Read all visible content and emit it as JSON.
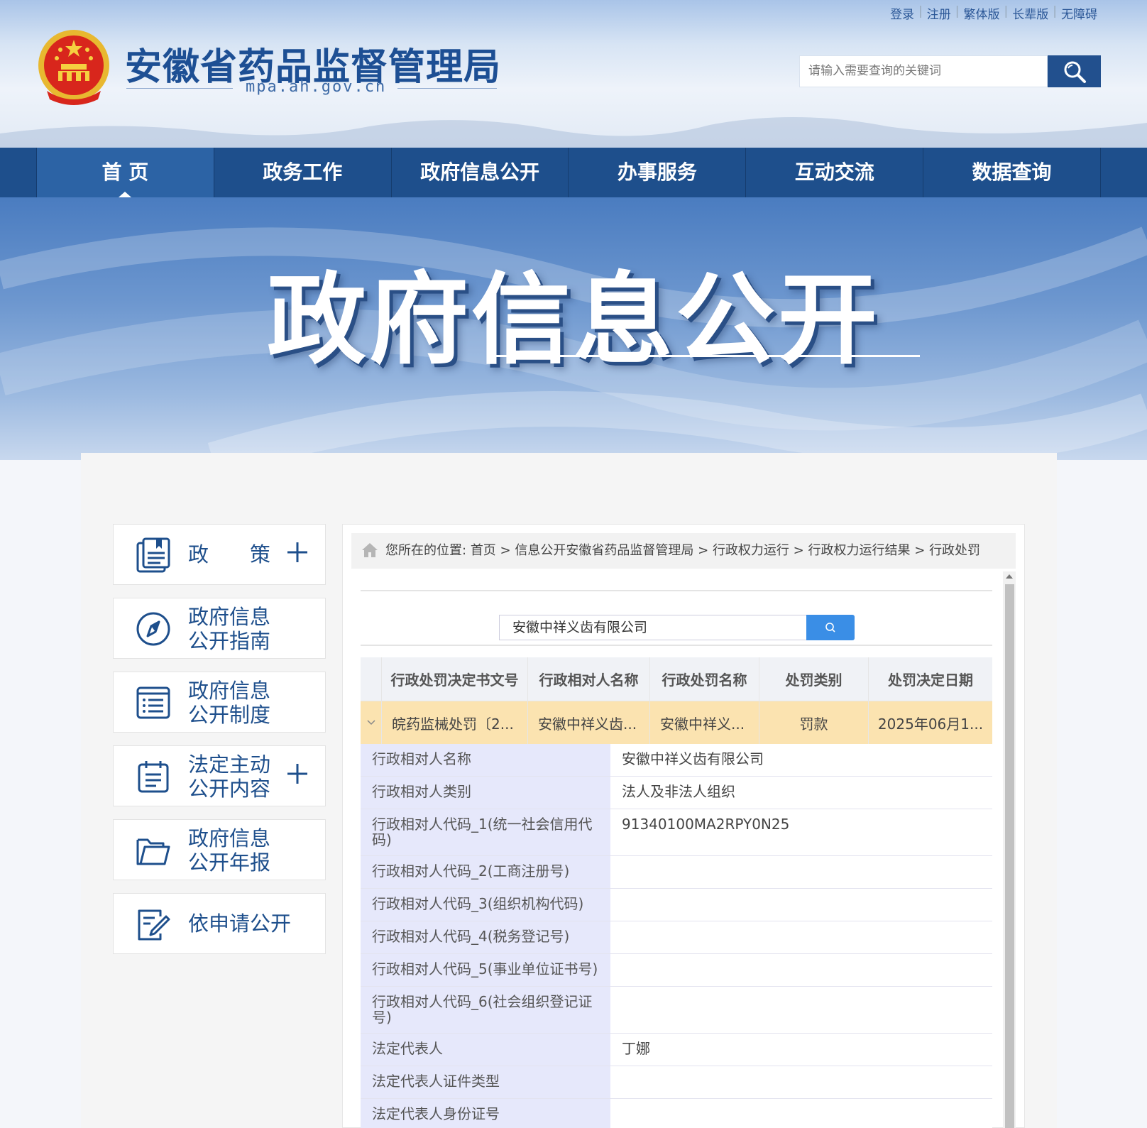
{
  "top_links": [
    "登录",
    "注册",
    "繁体版",
    "长辈版",
    "无障碍"
  ],
  "site": {
    "title": "安徽省药品监督管理局",
    "domain": "mpa.ah.gov.cn"
  },
  "search": {
    "placeholder": "请输入需要查询的关键词"
  },
  "nav": [
    "首 页",
    "政务工作",
    "政府信息公开",
    "办事服务",
    "互动交流",
    "数据查询"
  ],
  "banner": {
    "title": "政府信息公开"
  },
  "sidebar": [
    {
      "label": "政　　策",
      "icon": "document-icon",
      "has_plus": true
    },
    {
      "label": "政府信息\n公开指南",
      "icon": "compass-icon",
      "has_plus": false
    },
    {
      "label": "政府信息\n公开制度",
      "icon": "list-icon",
      "has_plus": false
    },
    {
      "label": "法定主动\n公开内容",
      "icon": "calendar-icon",
      "has_plus": true
    },
    {
      "label": "政府信息\n公开年报",
      "icon": "folder-icon",
      "has_plus": false
    },
    {
      "label": "依申请公开",
      "icon": "edit-icon",
      "has_plus": false
    }
  ],
  "breadcrumb": {
    "prefix": "您所在的位置:",
    "items": [
      "首页",
      "信息公开安徽省药品监督管理局",
      "行政权力运行",
      "行政权力运行结果",
      "行政处罚"
    ],
    "separator": ">"
  },
  "query": {
    "value": "安徽中祥义齿有限公司"
  },
  "table": {
    "headers": [
      "行政处罚决定书文号",
      "行政相对人名称",
      "行政处罚名称",
      "处罚类别",
      "处罚决定日期"
    ],
    "row": [
      "皖药监械处罚〔2...",
      "安徽中祥义齿...",
      "安徽中祥义...",
      "罚款",
      "2025年06月1..."
    ]
  },
  "details": [
    {
      "label": "行政相对人名称",
      "value": "安徽中祥义齿有限公司"
    },
    {
      "label": "行政相对人类别",
      "value": "法人及非法人组织"
    },
    {
      "label": "行政相对人代码_1(统一社会信用代码)",
      "value": "91340100MA2RPY0N25"
    },
    {
      "label": "行政相对人代码_2(工商注册号)",
      "value": ""
    },
    {
      "label": "行政相对人代码_3(组织机构代码)",
      "value": ""
    },
    {
      "label": "行政相对人代码_4(税务登记号)",
      "value": ""
    },
    {
      "label": "行政相对人代码_5(事业单位证书号)",
      "value": ""
    },
    {
      "label": "行政相对人代码_6(社会组织登记证号)",
      "value": ""
    },
    {
      "label": "法定代表人",
      "value": "丁娜"
    },
    {
      "label": "法定代表人证件类型",
      "value": ""
    },
    {
      "label": "法定代表人身份证号",
      "value": ""
    }
  ],
  "colors": {
    "nav_bg": "#1e4f8c",
    "title_blue": "#1d4f94",
    "highlight_row": "#fbe3b0",
    "label_bg": "#e6e8fb",
    "query_btn": "#3a8ee6"
  }
}
